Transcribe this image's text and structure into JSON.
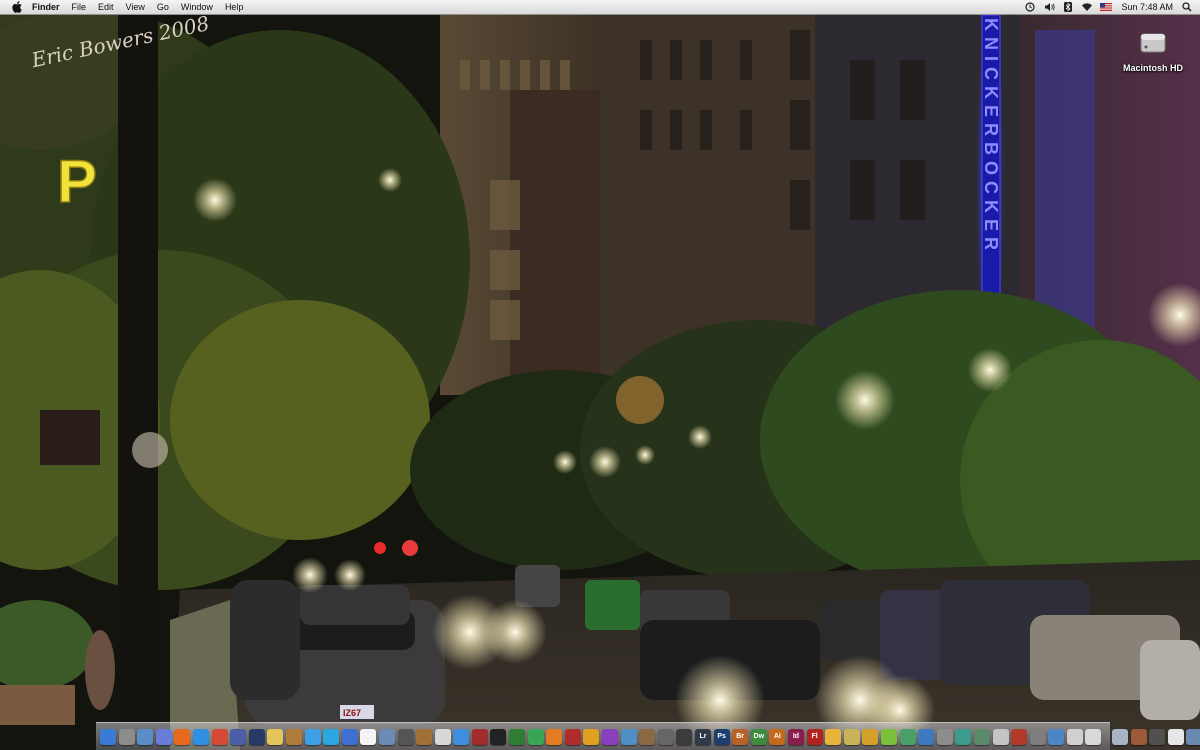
{
  "menubar": {
    "app_name": "Finder",
    "menus": [
      "File",
      "Edit",
      "View",
      "Go",
      "Window",
      "Help"
    ],
    "status_icons": [
      "time-machine-icon",
      "volume-icon",
      "bluetooth-icon",
      "wifi-icon",
      "flag-icon"
    ],
    "clock": "Sun 7:48 AM"
  },
  "desktop": {
    "icons": [
      {
        "label": "Macintosh HD",
        "icon": "hard-drive-icon"
      }
    ]
  },
  "wallpaper": {
    "signature": "Eric Bowers 2008",
    "parking_sign": "P",
    "neon_sign": "KNICKERBOCKER",
    "license_plate": "IZ67"
  },
  "dock": {
    "items": [
      {
        "name": "finder-icon",
        "label": "",
        "color": "#3a7bd5"
      },
      {
        "name": "system-preferences-icon",
        "label": "",
        "color": "#8c8c8c"
      },
      {
        "name": "preview-icon",
        "label": "",
        "color": "#5b8dc9"
      },
      {
        "name": "itunes-icon",
        "label": "",
        "color": "#6b7bd8"
      },
      {
        "name": "firefox-icon",
        "label": "",
        "color": "#e76a1c"
      },
      {
        "name": "safari-icon",
        "label": "",
        "color": "#2f8fe0"
      },
      {
        "name": "chrome-icon",
        "label": "",
        "color": "#d64a35"
      },
      {
        "name": "network-icon",
        "label": "",
        "color": "#4a5fa8"
      },
      {
        "name": "dashboard-icon",
        "label": "",
        "color": "#263a66"
      },
      {
        "name": "notes-icon",
        "label": "",
        "color": "#e3c55a"
      },
      {
        "name": "address-book-icon",
        "label": "",
        "color": "#b07c3b"
      },
      {
        "name": "ichat-icon",
        "label": "",
        "color": "#3da0e6"
      },
      {
        "name": "skype-icon",
        "label": "",
        "color": "#2aa7e0"
      },
      {
        "name": "itunes-alt-icon",
        "label": "",
        "color": "#3e6fd1"
      },
      {
        "name": "calendar-icon",
        "label": "",
        "color": "#f4f4f4"
      },
      {
        "name": "iphoto-icon",
        "label": "",
        "color": "#6c8bb5"
      },
      {
        "name": "imovie-icon",
        "label": "",
        "color": "#555555"
      },
      {
        "name": "garageband-icon",
        "label": "",
        "color": "#a07038"
      },
      {
        "name": "textedit-icon",
        "label": "",
        "color": "#d8d8d8"
      },
      {
        "name": "app-store-icon",
        "label": "",
        "color": "#3e8ee0"
      },
      {
        "name": "photo-booth-icon",
        "label": "",
        "color": "#a22b2b"
      },
      {
        "name": "terminal-icon",
        "label": "",
        "color": "#222222"
      },
      {
        "name": "activity-monitor-icon",
        "label": "",
        "color": "#2e7d32"
      },
      {
        "name": "utility-icon",
        "label": "",
        "color": "#3aa655"
      },
      {
        "name": "vlc-icon",
        "label": "",
        "color": "#e27b22"
      },
      {
        "name": "filezilla-icon",
        "label": "",
        "color": "#b02c2c"
      },
      {
        "name": "transmit-icon",
        "label": "",
        "color": "#e0a020"
      },
      {
        "name": "widget-icon",
        "label": "",
        "color": "#8a3fbf"
      },
      {
        "name": "maps-icon",
        "label": "",
        "color": "#4f8fc4"
      },
      {
        "name": "bookmarks-icon",
        "label": "",
        "color": "#8a6a44"
      },
      {
        "name": "camera-icon",
        "label": "",
        "color": "#666666"
      },
      {
        "name": "aperture-icon",
        "label": "",
        "color": "#3c3c3c"
      },
      {
        "name": "lightroom-icon",
        "label": "Lr",
        "color": "#2f3a48"
      },
      {
        "name": "photoshop-icon",
        "label": "Ps",
        "color": "#1e3e6d"
      },
      {
        "name": "bridge-icon",
        "label": "Br",
        "color": "#b8622a"
      },
      {
        "name": "dreamweaver-icon",
        "label": "Dw",
        "color": "#3c8c3c"
      },
      {
        "name": "illustrator-icon",
        "label": "Ai",
        "color": "#c26a1a"
      },
      {
        "name": "indesign-icon",
        "label": "Id",
        "color": "#8a1d4e"
      },
      {
        "name": "flash-icon",
        "label": "Fl",
        "color": "#b0231e"
      },
      {
        "name": "emoji-icon",
        "label": "",
        "color": "#e8b53a"
      },
      {
        "name": "settings-icon",
        "label": "",
        "color": "#c9b25a"
      },
      {
        "name": "star-icon",
        "label": "",
        "color": "#d4a12a"
      },
      {
        "name": "adium-icon",
        "label": "",
        "color": "#7bbf3a"
      },
      {
        "name": "sync-icon",
        "label": "",
        "color": "#4aa06a"
      },
      {
        "name": "globe-icon",
        "label": "",
        "color": "#3e7ac0"
      },
      {
        "name": "disk-utility-icon",
        "label": "",
        "color": "#8d8d8d"
      },
      {
        "name": "airport-icon",
        "label": "",
        "color": "#3c9c8c"
      },
      {
        "name": "compass-icon",
        "label": "",
        "color": "#5a8a6a"
      },
      {
        "name": "stack-icon",
        "label": "",
        "color": "#c4c4c4"
      },
      {
        "name": "arrows-icon",
        "label": "",
        "color": "#b33a2a"
      },
      {
        "name": "scripts-icon",
        "label": "",
        "color": "#7e7e7e"
      },
      {
        "name": "downloads-icon",
        "label": "",
        "color": "#4c86c8"
      },
      {
        "name": "documents-icon",
        "label": "",
        "color": "#d0d0d0"
      },
      {
        "name": "spotlight-icon",
        "label": "",
        "color": "#d9d9d9"
      },
      {
        "name": "folder-icon",
        "label": "",
        "color": "#a9b5c7"
      },
      {
        "name": "image-file-icon",
        "label": "",
        "color": "#9c5a3a"
      },
      {
        "name": "movie-file-icon",
        "label": "",
        "color": "#505050"
      },
      {
        "name": "document-file-icon",
        "label": "",
        "color": "#e6e6e6"
      },
      {
        "name": "applications-folder-icon",
        "label": "",
        "color": "#6a88b0"
      },
      {
        "name": "stack-folder-icon",
        "label": "",
        "color": "#3a3a3a"
      },
      {
        "name": "screenshot-icon",
        "label": "",
        "color": "#dcdcdc"
      },
      {
        "name": "trash-icon",
        "label": "",
        "color": "#b8b8b8"
      }
    ]
  }
}
